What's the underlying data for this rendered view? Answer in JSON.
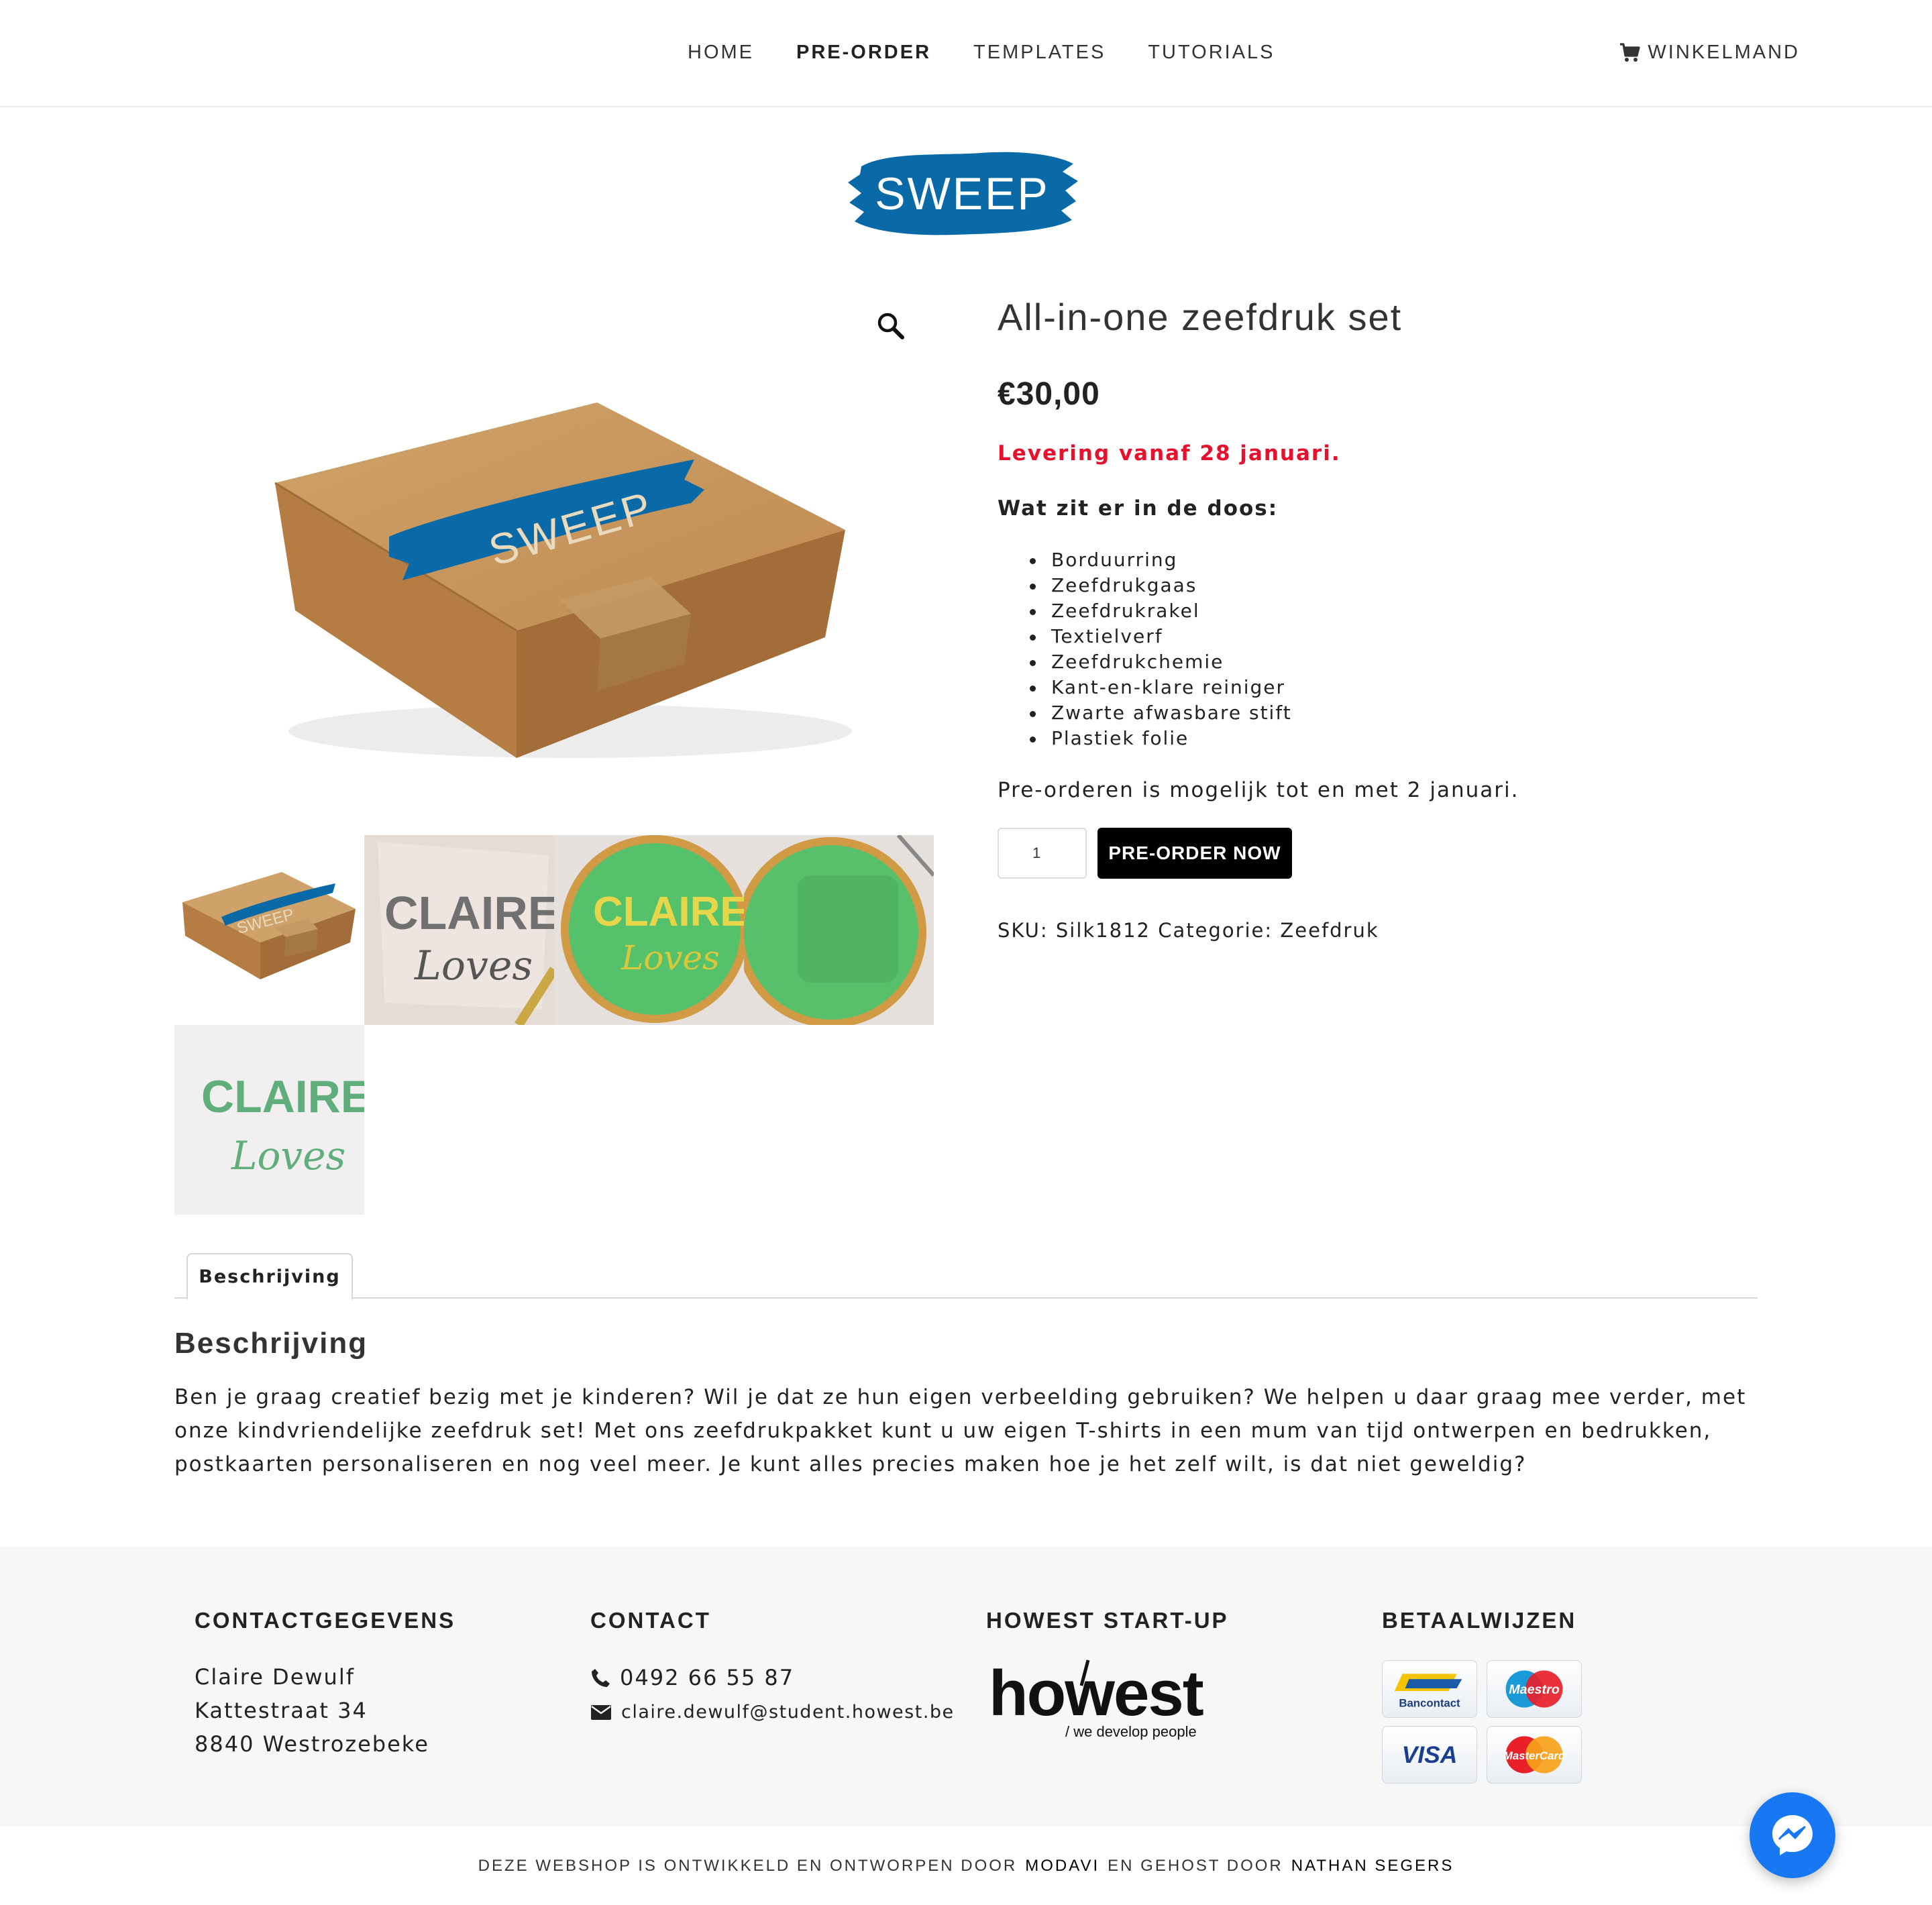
{
  "nav": {
    "items": [
      "HOME",
      "PRE-ORDER",
      "TEMPLATES",
      "TUTORIALS"
    ],
    "active_index": 1,
    "cart_label": "WINKELMAND"
  },
  "brand": {
    "logo_text": "SWEEP",
    "color": "#0a6aa8"
  },
  "product": {
    "title": "All-in-one zeefdruk set",
    "price": "€30,00",
    "delivery": "Levering vanaf 28 januari.",
    "box_heading": "Wat zit er in de doos:",
    "items": [
      "Borduurring",
      "Zeefdrukgaas",
      "Zeefdrukrakel",
      "Textielverf",
      "Zeefdrukchemie",
      "Kant-en-klare reiniger",
      "Zwarte afwasbare stift",
      "Plastiek folie"
    ],
    "preorder_note": "Pre-orderen is mogelijk tot en met 2 januari.",
    "quantity": "1",
    "button_label": "PRE-ORDER NOW",
    "meta": "SKU: Silk1812 Categorie: Zeefdruk",
    "image_texts": {
      "box_logo": "SWEEP",
      "claire": "CLAIRE",
      "loves": "Loves"
    }
  },
  "tabs": {
    "active": "Beschrijving"
  },
  "description": {
    "title": "Beschrijving",
    "text": "Ben je graag creatief bezig met je kinderen? Wil je dat ze hun eigen verbeelding gebruiken? We helpen u daar graag mee verder, met onze kindvriendelijke zeefdruk set! Met ons zeefdrukpakket kunt u uw eigen T-shirts in een mum van tijd ontwerpen en bedrukken, postkaarten personaliseren en nog veel meer. Je kunt alles precies maken hoe je het zelf wilt, is dat niet geweldig?"
  },
  "footer": {
    "contact_details": {
      "heading": "CONTACTGEGEVENS",
      "lines": [
        "Claire Dewulf",
        "Kattestraat 34",
        "8840 Westrozebeke"
      ]
    },
    "contact": {
      "heading": "CONTACT",
      "phone": "0492 66 55 87",
      "email": "claire.dewulf@student.howest.be"
    },
    "startup": {
      "heading": "HOWEST START-UP",
      "logo_text": "howest",
      "logo_tagline": "/ we develop people"
    },
    "payments": {
      "heading": "BETAALWIJZEN",
      "cards": [
        "Bancontact",
        "Maestro",
        "VISA",
        "MasterCard"
      ]
    }
  },
  "credits": {
    "prefix": "DEZE WEBSHOP IS ONTWIKKELD EN ONTWORPEN DOOR",
    "studio": "MODAVI",
    "middle": "EN GEHOST DOOR",
    "host": "NATHAN SEGERS"
  },
  "icons": [
    "cart-icon",
    "zoom-icon",
    "phone-icon",
    "mail-icon",
    "messenger-icon"
  ]
}
